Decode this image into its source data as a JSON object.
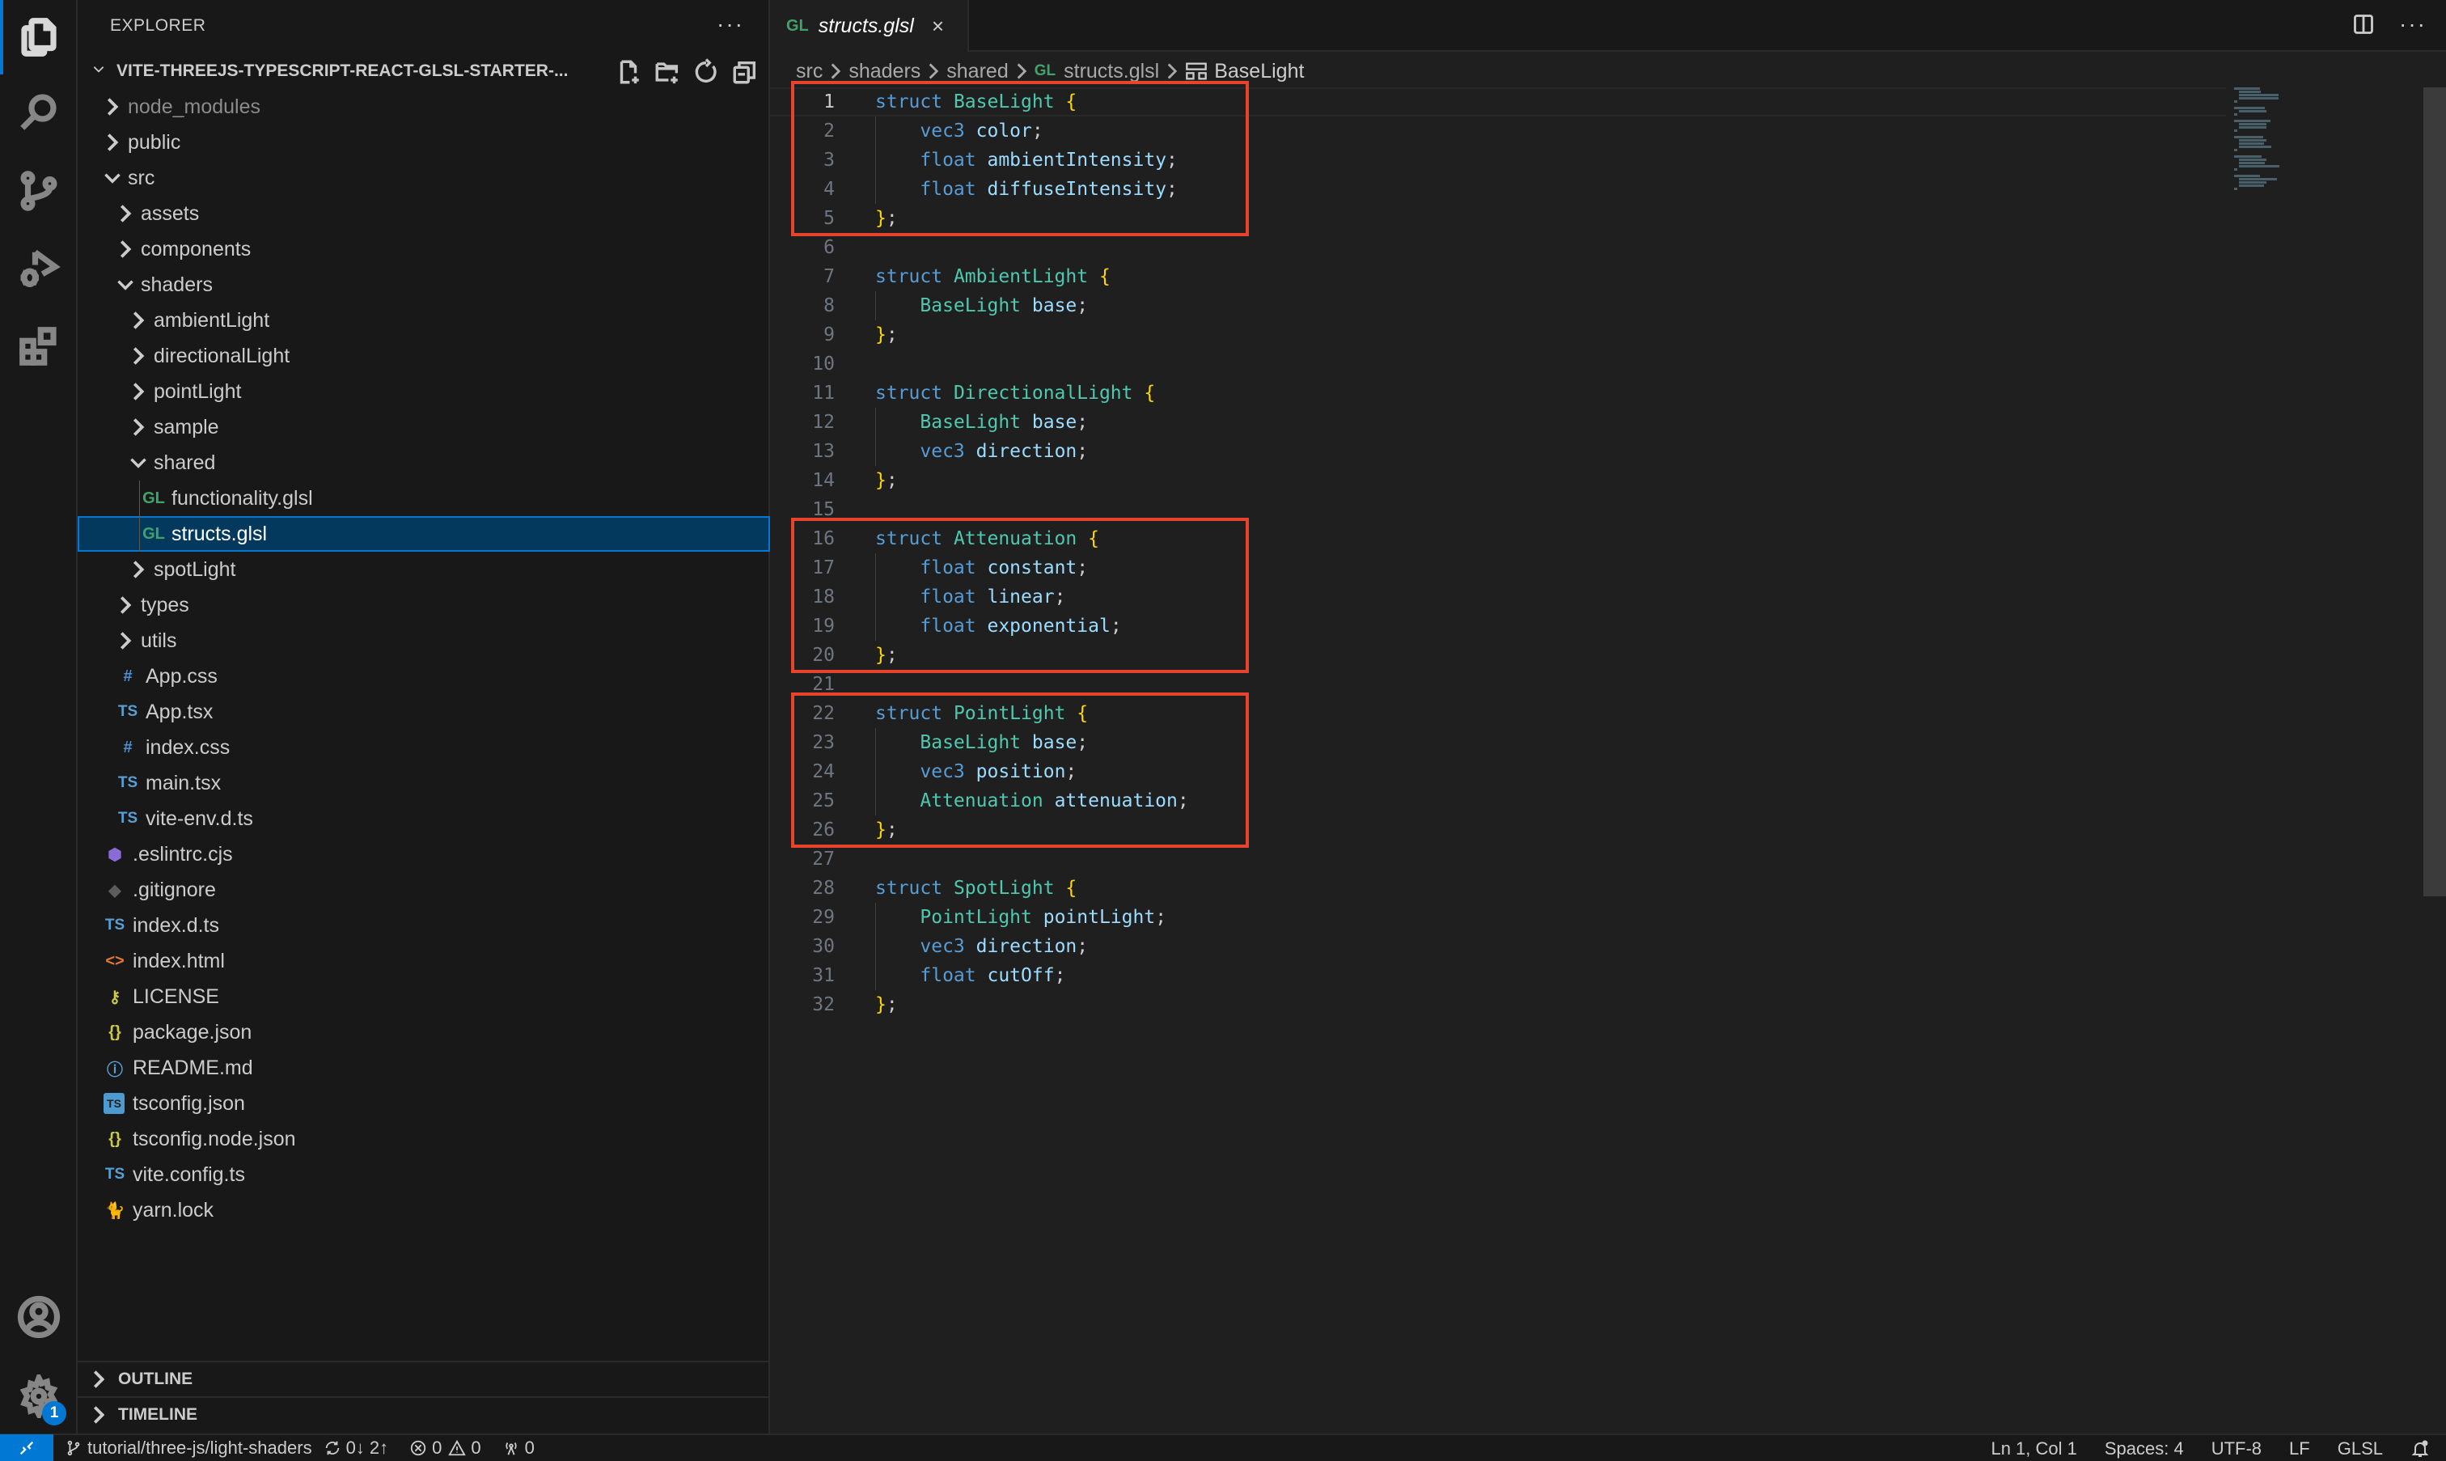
{
  "activity_bar": {
    "items": [
      {
        "name": "explorer",
        "active": true
      },
      {
        "name": "search"
      },
      {
        "name": "source-control"
      },
      {
        "name": "run-and-debug"
      },
      {
        "name": "extensions"
      }
    ],
    "accounts": "accounts",
    "manage": "manage",
    "manage_badge": "1"
  },
  "sidebar": {
    "title": "EXPLORER",
    "more_label": "···",
    "root_folder": "VITE-THREEJS-TYPESCRIPT-REACT-GLSL-STARTER-...",
    "root_actions": [
      "new-file",
      "new-folder",
      "refresh",
      "collapse-all"
    ],
    "tree": [
      {
        "label": "node_modules",
        "type": "folder",
        "expanded": false,
        "depth": 0,
        "dim": true
      },
      {
        "label": "public",
        "type": "folder",
        "expanded": false,
        "depth": 0
      },
      {
        "label": "src",
        "type": "folder",
        "expanded": true,
        "depth": 0
      },
      {
        "label": "assets",
        "type": "folder",
        "expanded": false,
        "depth": 1
      },
      {
        "label": "components",
        "type": "folder",
        "expanded": false,
        "depth": 1
      },
      {
        "label": "shaders",
        "type": "folder",
        "expanded": true,
        "depth": 1
      },
      {
        "label": "ambientLight",
        "type": "folder",
        "expanded": false,
        "depth": 2
      },
      {
        "label": "directionalLight",
        "type": "folder",
        "expanded": false,
        "depth": 2
      },
      {
        "label": "pointLight",
        "type": "folder",
        "expanded": false,
        "depth": 2
      },
      {
        "label": "sample",
        "type": "folder",
        "expanded": false,
        "depth": 2
      },
      {
        "label": "shared",
        "type": "folder",
        "expanded": true,
        "depth": 2
      },
      {
        "label": "functionality.glsl",
        "type": "file",
        "icon": "GL",
        "icon_kind": "gl",
        "depth": 3
      },
      {
        "label": "structs.glsl",
        "type": "file",
        "icon": "GL",
        "icon_kind": "gl",
        "depth": 3,
        "selected": true
      },
      {
        "label": "spotLight",
        "type": "folder",
        "expanded": false,
        "depth": 2
      },
      {
        "label": "types",
        "type": "folder",
        "expanded": false,
        "depth": 1
      },
      {
        "label": "utils",
        "type": "folder",
        "expanded": false,
        "depth": 1
      },
      {
        "label": "App.css",
        "type": "file",
        "icon": "#",
        "icon_kind": "css",
        "depth": 1
      },
      {
        "label": "App.tsx",
        "type": "file",
        "icon": "TS",
        "icon_kind": "ts",
        "depth": 1
      },
      {
        "label": "index.css",
        "type": "file",
        "icon": "#",
        "icon_kind": "css",
        "depth": 1
      },
      {
        "label": "main.tsx",
        "type": "file",
        "icon": "TS",
        "icon_kind": "ts",
        "depth": 1
      },
      {
        "label": "vite-env.d.ts",
        "type": "file",
        "icon": "TS",
        "icon_kind": "ts",
        "depth": 1
      },
      {
        "label": ".eslintrc.cjs",
        "type": "file",
        "icon": "⬢",
        "icon_kind": "eslint",
        "depth": 0
      },
      {
        "label": ".gitignore",
        "type": "file",
        "icon": "◆",
        "icon_kind": "git",
        "depth": 0
      },
      {
        "label": "index.d.ts",
        "type": "file",
        "icon": "TS",
        "icon_kind": "ts",
        "depth": 0
      },
      {
        "label": "index.html",
        "type": "file",
        "icon": "<>",
        "icon_kind": "html",
        "depth": 0
      },
      {
        "label": "LICENSE",
        "type": "file",
        "icon": "⚷",
        "icon_kind": "license",
        "depth": 0
      },
      {
        "label": "package.json",
        "type": "file",
        "icon": "{}",
        "icon_kind": "json",
        "depth": 0
      },
      {
        "label": "README.md",
        "type": "file",
        "icon": "ⓘ",
        "icon_kind": "info",
        "depth": 0
      },
      {
        "label": "tsconfig.json",
        "type": "file",
        "icon": "TS",
        "icon_kind": "tsconf",
        "depth": 0
      },
      {
        "label": "tsconfig.node.json",
        "type": "file",
        "icon": "{}",
        "icon_kind": "json",
        "depth": 0
      },
      {
        "label": "vite.config.ts",
        "type": "file",
        "icon": "TS",
        "icon_kind": "ts",
        "depth": 0
      },
      {
        "label": "yarn.lock",
        "type": "file",
        "icon": "🐈",
        "icon_kind": "yarn",
        "depth": 0
      }
    ],
    "outline_label": "OUTLINE",
    "timeline_label": "TIMELINE"
  },
  "editor": {
    "tab": {
      "icon": "GL",
      "label": "structs.glsl",
      "close": "×"
    },
    "tab_actions_more": "···",
    "breadcrumb": [
      "src",
      "shaders",
      "shared",
      "structs.glsl",
      "BaseLight"
    ],
    "breadcrumb_file_icon": "GL",
    "active_line": 1,
    "lines": [
      [
        [
          "k",
          "struct "
        ],
        [
          "t",
          "BaseLight"
        ],
        [
          "p",
          " "
        ],
        [
          "b",
          "{"
        ]
      ],
      [
        [
          "p",
          "    "
        ],
        [
          "k",
          "vec3 "
        ],
        [
          "v",
          "color"
        ],
        [
          "p",
          ";"
        ]
      ],
      [
        [
          "p",
          "    "
        ],
        [
          "k",
          "float "
        ],
        [
          "v",
          "ambientIntensity"
        ],
        [
          "p",
          ";"
        ]
      ],
      [
        [
          "p",
          "    "
        ],
        [
          "k",
          "float "
        ],
        [
          "v",
          "diffuseIntensity"
        ],
        [
          "p",
          ";"
        ]
      ],
      [
        [
          "b",
          "}"
        ],
        [
          "p",
          ";"
        ]
      ],
      [],
      [
        [
          "k",
          "struct "
        ],
        [
          "t",
          "AmbientLight"
        ],
        [
          "p",
          " "
        ],
        [
          "b",
          "{"
        ]
      ],
      [
        [
          "p",
          "    "
        ],
        [
          "t",
          "BaseLight "
        ],
        [
          "v",
          "base"
        ],
        [
          "p",
          ";"
        ]
      ],
      [
        [
          "b",
          "}"
        ],
        [
          "p",
          ";"
        ]
      ],
      [],
      [
        [
          "k",
          "struct "
        ],
        [
          "t",
          "DirectionalLight"
        ],
        [
          "p",
          " "
        ],
        [
          "b",
          "{"
        ]
      ],
      [
        [
          "p",
          "    "
        ],
        [
          "t",
          "BaseLight "
        ],
        [
          "v",
          "base"
        ],
        [
          "p",
          ";"
        ]
      ],
      [
        [
          "p",
          "    "
        ],
        [
          "k",
          "vec3 "
        ],
        [
          "v",
          "direction"
        ],
        [
          "p",
          ";"
        ]
      ],
      [
        [
          "b",
          "}"
        ],
        [
          "p",
          ";"
        ]
      ],
      [],
      [
        [
          "k",
          "struct "
        ],
        [
          "t",
          "Attenuation"
        ],
        [
          "p",
          " "
        ],
        [
          "b",
          "{"
        ]
      ],
      [
        [
          "p",
          "    "
        ],
        [
          "k",
          "float "
        ],
        [
          "v",
          "constant"
        ],
        [
          "p",
          ";"
        ]
      ],
      [
        [
          "p",
          "    "
        ],
        [
          "k",
          "float "
        ],
        [
          "v",
          "linear"
        ],
        [
          "p",
          ";"
        ]
      ],
      [
        [
          "p",
          "    "
        ],
        [
          "k",
          "float "
        ],
        [
          "v",
          "exponential"
        ],
        [
          "p",
          ";"
        ]
      ],
      [
        [
          "b",
          "}"
        ],
        [
          "p",
          ";"
        ]
      ],
      [],
      [
        [
          "k",
          "struct "
        ],
        [
          "t",
          "PointLight"
        ],
        [
          "p",
          " "
        ],
        [
          "b",
          "{"
        ]
      ],
      [
        [
          "p",
          "    "
        ],
        [
          "t",
          "BaseLight "
        ],
        [
          "v",
          "base"
        ],
        [
          "p",
          ";"
        ]
      ],
      [
        [
          "p",
          "    "
        ],
        [
          "k",
          "vec3 "
        ],
        [
          "v",
          "position"
        ],
        [
          "p",
          ";"
        ]
      ],
      [
        [
          "p",
          "    "
        ],
        [
          "t",
          "Attenuation "
        ],
        [
          "v",
          "attenuation"
        ],
        [
          "p",
          ";"
        ]
      ],
      [
        [
          "b",
          "}"
        ],
        [
          "p",
          ";"
        ]
      ],
      [],
      [
        [
          "k",
          "struct "
        ],
        [
          "t",
          "SpotLight"
        ],
        [
          "p",
          " "
        ],
        [
          "b",
          "{"
        ]
      ],
      [
        [
          "p",
          "    "
        ],
        [
          "t",
          "PointLight "
        ],
        [
          "v",
          "pointLight"
        ],
        [
          "p",
          ";"
        ]
      ],
      [
        [
          "p",
          "    "
        ],
        [
          "k",
          "vec3 "
        ],
        [
          "v",
          "direction"
        ],
        [
          "p",
          ";"
        ]
      ],
      [
        [
          "p",
          "    "
        ],
        [
          "k",
          "float "
        ],
        [
          "v",
          "cutOff"
        ],
        [
          "p",
          ";"
        ]
      ],
      [
        [
          "b",
          "}"
        ],
        [
          "p",
          ";"
        ]
      ]
    ],
    "highlight_boxes": [
      {
        "from_line": 1,
        "to_line": 5,
        "color": "#e8432d"
      },
      {
        "from_line": 16,
        "to_line": 20,
        "color": "#e8432d"
      },
      {
        "from_line": 22,
        "to_line": 26,
        "color": "#e8432d"
      }
    ]
  },
  "statusbar": {
    "branch": "tutorial/three-js/light-shaders",
    "sync": "0↓ 2↑",
    "errors": "0",
    "warnings": "0",
    "ports": "0",
    "cursor": "Ln 1, Col 1",
    "indent": "Spaces: 4",
    "encoding": "UTF-8",
    "eol": "LF",
    "language": "GLSL"
  },
  "colors": {
    "accent": "#0078d4",
    "keyword": "#569cd6",
    "type": "#4ec9b0",
    "variable": "#9cdcfe",
    "bracket": "#ffd700",
    "annotation": "#e8432d"
  }
}
